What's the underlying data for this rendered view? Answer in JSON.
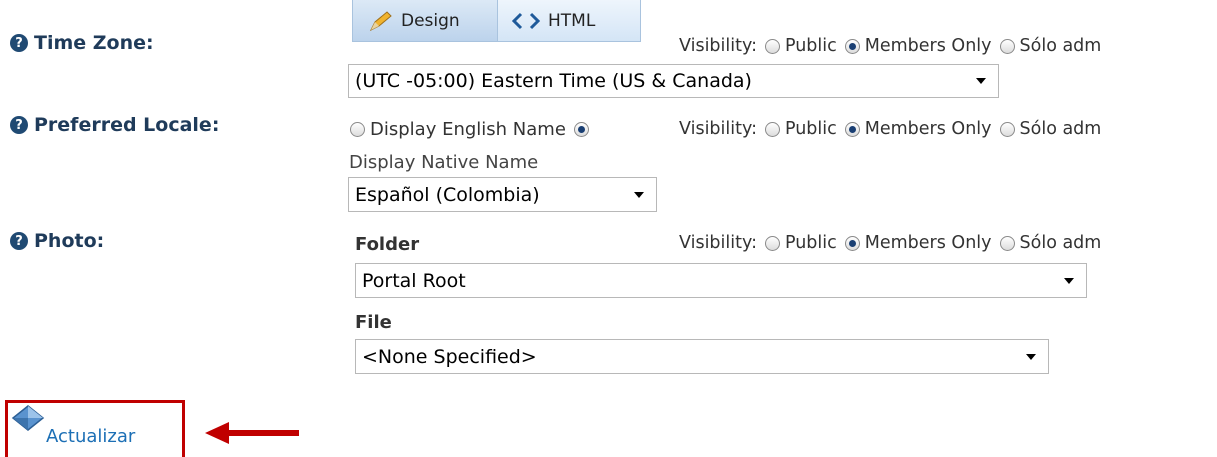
{
  "editor_tabs": {
    "design": "Design",
    "html": "HTML"
  },
  "fields": {
    "time_zone": {
      "label": "Time Zone",
      "value": "(UTC -05:00) Eastern Time (US & Canada)"
    },
    "preferred_locale": {
      "label": "Preferred Locale",
      "option_english": "Display English Name",
      "option_native": "Display Native Name",
      "value": "Español (Colombia)"
    },
    "photo": {
      "label": "Photo",
      "folder_label": "Folder",
      "folder_value": "Portal Root",
      "file_label": "File",
      "file_value": "<None Specified>"
    }
  },
  "visibility": {
    "label": "Visibility:",
    "public": "Public",
    "members_only": "Members Only",
    "admin": "Sólo adm"
  },
  "label_colon": ":",
  "update_button": {
    "label": "Actualizar"
  },
  "colors": {
    "label": "#1f3b5a",
    "link": "#1c6fb5",
    "highlight": "#c00000"
  },
  "icons": [
    "help-icon",
    "pencil-icon",
    "code-icon",
    "update-icon",
    "arrow-left-icon"
  ]
}
